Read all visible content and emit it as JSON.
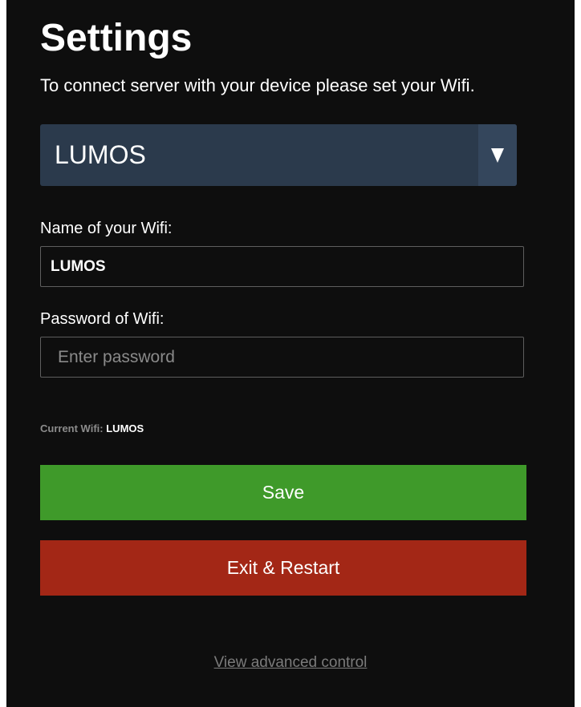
{
  "header": {
    "title": "Settings",
    "subtitle": "To connect server with your device please set your Wifi."
  },
  "network_select": {
    "selected": "LUMOS",
    "arrow_icon": "triangle-down-icon"
  },
  "ssid_field": {
    "label": "Name of your Wifi:",
    "value": "LUMOS"
  },
  "password_field": {
    "label": "Password of Wifi:",
    "value": "",
    "placeholder": "Enter password"
  },
  "status": {
    "current_wifi_label": "Current Wifi:",
    "current_wifi_value": "LUMOS"
  },
  "actions": {
    "save_label": "Save",
    "exit_label": "Exit & Restart",
    "advanced_link": "View advanced control"
  },
  "colors": {
    "background": "#0e0e0e",
    "select_background": "#2b3a4c",
    "save": "#3f9a2a",
    "exit": "#a32716"
  }
}
